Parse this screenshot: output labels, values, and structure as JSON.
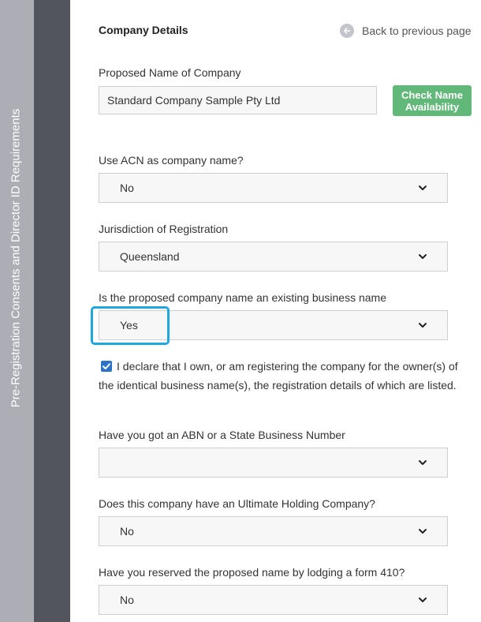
{
  "sidebar": {
    "outer_label": "Pre-Registration Consents and Director ID Requirements",
    "inner_label": "Company Details"
  },
  "header": {
    "title": "Company Details",
    "back_label": "Back to previous page"
  },
  "company_name": {
    "label": "Proposed Name of Company",
    "value": "Standard Company Sample Pty Ltd",
    "check_button": "Check Name Availability"
  },
  "fields": {
    "acn": {
      "label": "Use ACN as company name?",
      "value": "No"
    },
    "jurisdiction": {
      "label": "Jurisdiction of Registration",
      "value": "Queensland"
    },
    "existing_business": {
      "label": "Is the proposed company name an existing business name",
      "value": "Yes"
    },
    "abn": {
      "label": "Have you got an ABN or a State Business Number",
      "value": ""
    },
    "holding": {
      "label": "Does this company have an Ultimate Holding Company?",
      "value": "No"
    },
    "form410": {
      "label": "Have you reserved the proposed name by lodging a form 410?",
      "value": "No"
    }
  },
  "declaration": {
    "checked": true,
    "text": "I declare that I own, or am registering the company for the owner(s) of the identical business name(s), the registration details of which are listed."
  },
  "colors": {
    "sidebar_outer": "#acadb5",
    "sidebar_inner": "#52555d",
    "check_button": "#62b879",
    "highlight": "#1fa8e0",
    "checkbox": "#2a73c9"
  },
  "icons": {
    "back": "arrow-left-circle-icon",
    "dropdown": "chevron-down-icon",
    "checkbox": "checkmark-icon"
  }
}
